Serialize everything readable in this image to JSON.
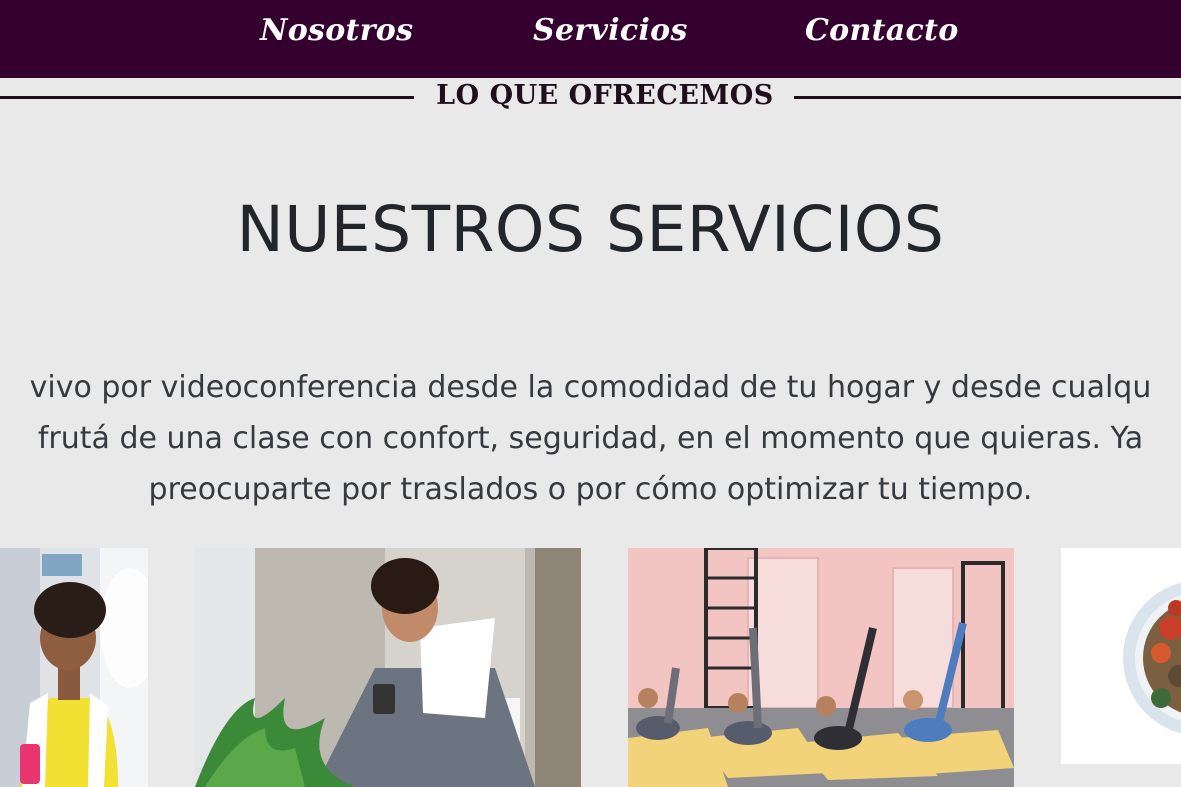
{
  "nav": {
    "items": [
      "Nosotros",
      "Servicios",
      "Contacto"
    ]
  },
  "section": {
    "eyebrow": "LO QUE OFRECEMOS",
    "heading": "NUESTROS SERVICIOS",
    "description_lines": [
      "vivo por videoconferencia desde la comodidad de tu hogar y desde cualqu",
      "frutá de una clase con confort, seguridad, en el momento que quieras. Ya",
      "preocuparte por traslados o por cómo optimizar tu tiempo."
    ]
  },
  "colors": {
    "nav_background": "#34002e",
    "page_background": "#e9e9e9",
    "eyebrow_text": "#1f0f1d"
  }
}
